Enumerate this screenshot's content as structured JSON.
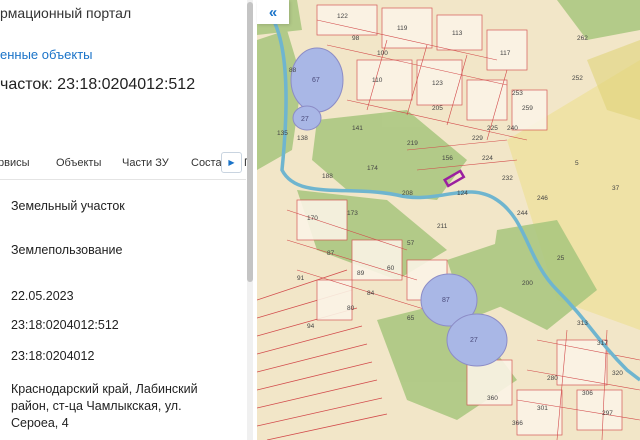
{
  "panel": {
    "portal_title": "рмационный портал",
    "selected_link": "енные объекты",
    "parcel_title": "часток: 23:18:0204012:512",
    "tabs": [
      {
        "label": "рвисы"
      },
      {
        "label": "Объекты"
      },
      {
        "label": "Части ЗУ"
      },
      {
        "label": "Соста"
      },
      {
        "label": "П"
      }
    ],
    "tab_next_icon": "chevron-right-icon",
    "fields": {
      "object_type": "Земельный участок",
      "permitted_use": "Землепользование",
      "date": "22.05.2023",
      "cadastral_number": "23:18:0204012:512",
      "quarter_number": "23:18:0204012",
      "address": "Краснодарский край, Лабинский район, ст-ца Чамлыкская, ул. Сероеа, 4"
    }
  },
  "map": {
    "collapse_icon": "double-chevron-left-icon",
    "colors": {
      "background": "#f2e6c8",
      "parcel_border": "#d24b4b",
      "vegetation": "#a8c67e",
      "water": "#a9b7e6",
      "river": "#6fb5cf",
      "selected": "#9b1fa0"
    },
    "parcel_numbers": [
      "122",
      "119",
      "113",
      "117",
      "110",
      "123",
      "5",
      "37",
      "88",
      "135",
      "138",
      "174",
      "219",
      "224",
      "188",
      "262",
      "252",
      "253",
      "259",
      "225",
      "240",
      "229",
      "205",
      "208",
      "232",
      "246",
      "244",
      "211",
      "170",
      "173",
      "57",
      "87",
      "89",
      "91",
      "84",
      "94",
      "60",
      "80",
      "65",
      "25",
      "200",
      "313",
      "317",
      "320",
      "280",
      "306",
      "301",
      "297",
      "360",
      "366",
      "98",
      "100",
      "141",
      "156",
      "124"
    ],
    "pond_labels": [
      "67",
      "27",
      "87",
      "27"
    ]
  }
}
